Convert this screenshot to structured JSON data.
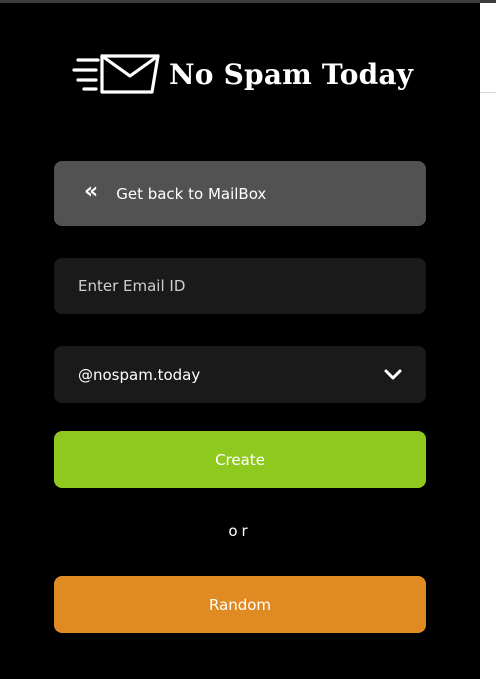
{
  "brand": {
    "logo_icon": "envelope-speed-icon",
    "name": "No Spam Today"
  },
  "back_button": {
    "icon": "double-chevron-left-icon",
    "label": "Get back to MailBox"
  },
  "email_input": {
    "placeholder": "Enter Email ID",
    "value": ""
  },
  "domain_select": {
    "value": "@nospam.today",
    "icon": "chevron-down-icon"
  },
  "create_button": {
    "label": "Create"
  },
  "separator": {
    "text": "or"
  },
  "random_button": {
    "label": "Random"
  },
  "colors": {
    "panel_bg": "#000000",
    "back_button_bg": "#525252",
    "field_bg": "#1a1a1a",
    "create_bg": "#8fc91f",
    "random_bg": "#e08b21"
  }
}
